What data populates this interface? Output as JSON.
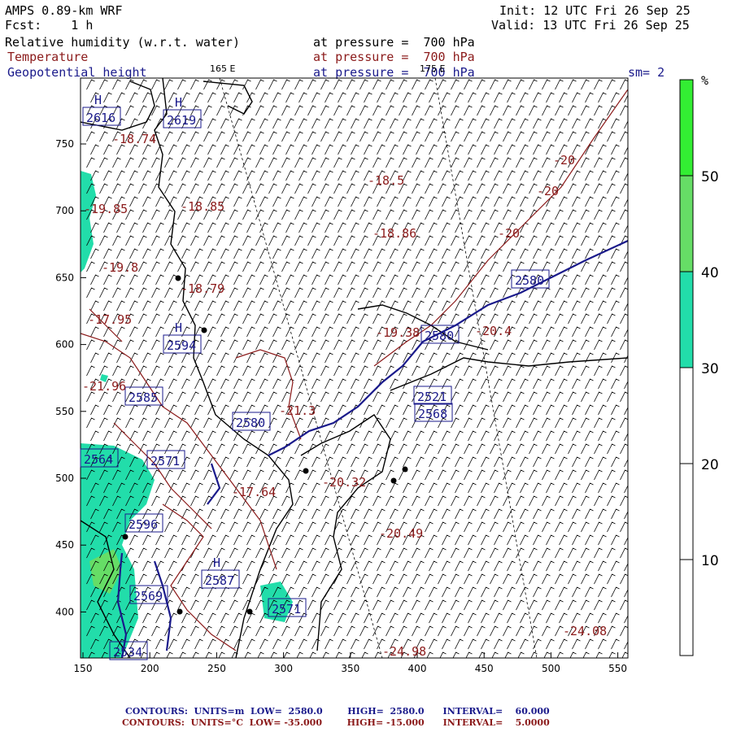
{
  "header": {
    "model": "AMPS 0.89-km WRF",
    "fcst": "Fcst:    1 h",
    "init": "Init: 12 UTC Fri 26 Sep 25",
    "valid": "Valid: 13 UTC Fri 26 Sep 25",
    "line1_label": "Relative humidity (w.r.t. water)",
    "line1_pressure": "at pressure =  700 hPa",
    "line2_label": "Temperature",
    "line2_pressure": "at pressure =  700 hPa",
    "line3_label": "Geopotential height",
    "line3_pressure": "at pressure =  700 hPa",
    "sm": "sm= 2",
    "lon_165": "165 E",
    "lon_175": "175 E"
  },
  "colorbar": {
    "unit": "%",
    "ticks": [
      "50",
      "40",
      "30",
      "20",
      "10"
    ],
    "colors": [
      "#33ee33",
      "#66dd66",
      "#22ddaa",
      "#ffffff",
      "#ffffff",
      "#ffffff"
    ]
  },
  "axes": {
    "x_ticks": [
      "150",
      "200",
      "250",
      "300",
      "350",
      "400",
      "450",
      "500",
      "550"
    ],
    "y_ticks": [
      "750",
      "700",
      "650",
      "600",
      "550",
      "500",
      "450",
      "400"
    ]
  },
  "labels": {
    "heights": [
      {
        "text": "2616",
        "mark": "H"
      },
      {
        "text": "2619",
        "mark": "H"
      },
      {
        "text": "2594",
        "mark": "H"
      },
      {
        "text": "2585",
        "mark": ""
      },
      {
        "text": "2580",
        "mark": ""
      },
      {
        "text": "2580",
        "mark": ""
      },
      {
        "text": "2580",
        "mark": ""
      },
      {
        "text": "2568",
        "mark": ""
      },
      {
        "text": "2521",
        "mark": ""
      },
      {
        "text": "2564",
        "mark": ""
      },
      {
        "text": "2571",
        "mark": ""
      },
      {
        "text": "2596",
        "mark": ""
      },
      {
        "text": "2569",
        "mark": ""
      },
      {
        "text": "2587",
        "mark": "H"
      },
      {
        "text": "2571",
        "mark": ""
      },
      {
        "text": "2534",
        "mark": ""
      }
    ],
    "temps": [
      "-18.74",
      "-18.85",
      "-18.5",
      "-18.86",
      "-19.8",
      "-18.79",
      "-17.95",
      "-19.38",
      "-20.4",
      "-20",
      "-20",
      "-20",
      "-21.3",
      "-17.64",
      "-20.32",
      "-20.49",
      "-24.98",
      "-24.08",
      "-21.96",
      "-19.85"
    ]
  },
  "footer": {
    "line1": "CONTOURS:  UNITS=m  LOW=  2580.0        HIGH=  2580.0      INTERVAL=    60.000",
    "line2": "CONTOURS:  UNITS=°C  LOW= -35.000        HIGH= -15.000      INTERVAL=    5.0000"
  }
}
